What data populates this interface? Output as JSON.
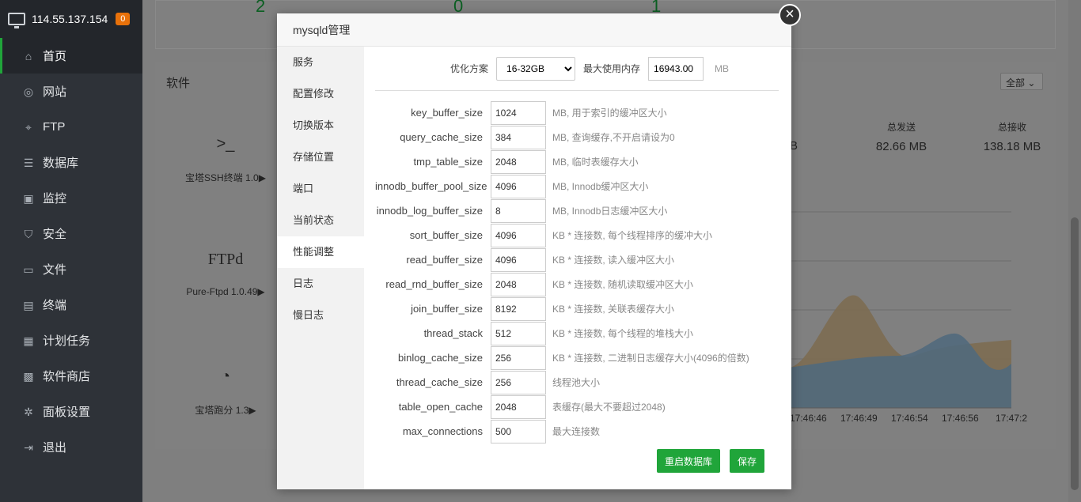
{
  "sidebar": {
    "ip": "114.55.137.154",
    "badge": "0",
    "items": [
      {
        "label": "首页",
        "icon": "home-icon",
        "glyph": "⌂"
      },
      {
        "label": "网站",
        "icon": "globe-icon",
        "glyph": "◎"
      },
      {
        "label": "FTP",
        "icon": "ftp-icon",
        "glyph": "⌖"
      },
      {
        "label": "数据库",
        "icon": "database-icon",
        "glyph": "☰"
      },
      {
        "label": "监控",
        "icon": "monitor-icon",
        "glyph": "▣"
      },
      {
        "label": "安全",
        "icon": "shield-icon",
        "glyph": "⛉"
      },
      {
        "label": "文件",
        "icon": "folder-icon",
        "glyph": "▭"
      },
      {
        "label": "终端",
        "icon": "terminal-icon",
        "glyph": "▤"
      },
      {
        "label": "计划任务",
        "icon": "calendar-icon",
        "glyph": "▦"
      },
      {
        "label": "软件商店",
        "icon": "apps-icon",
        "glyph": "▩"
      },
      {
        "label": "面板设置",
        "icon": "gear-icon",
        "glyph": "✲"
      },
      {
        "label": "退出",
        "icon": "logout-icon",
        "glyph": "⇥"
      }
    ]
  },
  "dashboard": {
    "top_numbers": [
      "2",
      "0",
      "1"
    ],
    "soft_title": "软件",
    "soft_filter": "全部",
    "soft_cards": [
      {
        "label": "宝塔SSH终端 1.0▶",
        "icon": ">_"
      },
      {
        "label": "Pure-Ftpd 1.0.49▶",
        "icon": "FTPd"
      },
      {
        "label": "宝塔跑分 1.3▶",
        "icon": "◔"
      }
    ],
    "partial_left": "宝",
    "stats": [
      {
        "label": "总发送",
        "value": "82.66 MB"
      },
      {
        "label": "总接收",
        "value": "138.18 MB"
      }
    ],
    "partial_value": "B",
    "x_ticks": [
      "17:46:46",
      "17:46:49",
      "17:46:54",
      "17:46:56",
      "17:47:2"
    ]
  },
  "modal": {
    "title": "mysqld管理",
    "close": "×",
    "tabs": [
      "服务",
      "配置修改",
      "切换版本",
      "存储位置",
      "端口",
      "当前状态",
      "性能调整",
      "日志",
      "慢日志"
    ],
    "active_tab": 6,
    "opt_label": "优化方案",
    "opt_value": "16-32GB",
    "max_mem_label": "最大使用内存",
    "max_mem_value": "16943.00",
    "max_mem_unit": "MB",
    "params": [
      {
        "name": "key_buffer_size",
        "value": "1024",
        "desc": "MB, 用于索引的缓冲区大小"
      },
      {
        "name": "query_cache_size",
        "value": "384",
        "desc": "MB, 查询缓存,不开启请设为0"
      },
      {
        "name": "tmp_table_size",
        "value": "2048",
        "desc": "MB, 临时表缓存大小"
      },
      {
        "name": "innodb_buffer_pool_size",
        "value": "4096",
        "desc": "MB, Innodb缓冲区大小"
      },
      {
        "name": "innodb_log_buffer_size",
        "value": "8",
        "desc": "MB, Innodb日志缓冲区大小"
      },
      {
        "name": "sort_buffer_size",
        "value": "4096",
        "desc": "KB * 连接数, 每个线程排序的缓冲大小"
      },
      {
        "name": "read_buffer_size",
        "value": "4096",
        "desc": "KB * 连接数, 读入缓冲区大小"
      },
      {
        "name": "read_rnd_buffer_size",
        "value": "2048",
        "desc": "KB * 连接数, 随机读取缓冲区大小"
      },
      {
        "name": "join_buffer_size",
        "value": "8192",
        "desc": "KB * 连接数, 关联表缓存大小"
      },
      {
        "name": "thread_stack",
        "value": "512",
        "desc": "KB * 连接数, 每个线程的堆栈大小"
      },
      {
        "name": "binlog_cache_size",
        "value": "256",
        "desc": "KB * 连接数, 二进制日志缓存大小(4096的倍数)"
      },
      {
        "name": "thread_cache_size",
        "value": "256",
        "desc": "线程池大小"
      },
      {
        "name": "table_open_cache",
        "value": "2048",
        "desc": "表缓存(最大不要超过2048)"
      },
      {
        "name": "max_connections",
        "value": "500",
        "desc": "最大连接数"
      }
    ],
    "restart_label": "重启数据库",
    "save_label": "保存"
  },
  "colors": {
    "accent": "#20a53a",
    "sidebar_bg": "#2e3238",
    "badge": "#e8710a"
  }
}
